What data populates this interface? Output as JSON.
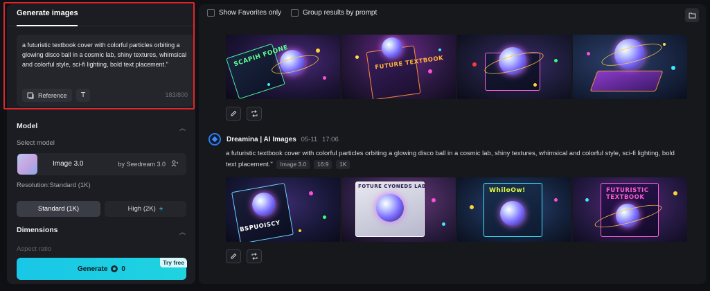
{
  "left_panel": {
    "tab_label": "Generate images",
    "prompt_text": "a futuristic textbook cover with colorful particles orbiting a glowing disco ball in a cosmic lab, shiny textures, whimsical and colorful style, sci-fi lighting, bold text placement.\"",
    "reference_label": "Reference",
    "text_tool_icon": "T",
    "char_count": "183/800",
    "model_section": {
      "title": "Model",
      "select_label": "Select model",
      "model_name": "Image 3.0",
      "model_by": "by Seedream 3.0",
      "resolution_label": "Resolution:Standard (1K)",
      "standard_label": "Standard (1K)",
      "high_label": "High (2K)",
      "high_plus": "+"
    },
    "dimensions_section": {
      "title": "Dimensions",
      "aspect_label": "Aspect ratio"
    },
    "generate": {
      "label": "Generate",
      "cost": "0",
      "badge": "Try free"
    }
  },
  "right_panel": {
    "show_favorites_label": "Show Favorites only",
    "group_results_label": "Group results by prompt",
    "result": {
      "author": "Dreamina | AI Images",
      "date": "05-11",
      "time": "17:06",
      "prompt": "a futuristic textbook cover with colorful particles orbiting a glowing disco ball in a cosmic lab, shiny textures, whimsical and colorful style, sci-fi lighting, bold text placement.\"",
      "tags": [
        "Image 3.0",
        "16:9",
        "1K"
      ]
    },
    "images_row1_captions": [
      "SCAPIH FOONE",
      "FUTURE TEXTBOOK",
      "",
      ""
    ],
    "images_row2_captions": [
      "BSPUOISCY",
      "FOTURE CYONEDS LAB",
      "WhiloOw!",
      "FUTURISTIC TEXTBOOK"
    ]
  },
  "icons": {
    "reference": "reference-image-icon",
    "text_tool": "text-format-icon",
    "model_settings": "sliders-icon",
    "chevron": "chevron-up-icon",
    "folder": "folder-icon",
    "edit": "pencil-icon",
    "regenerate": "regenerate-icon",
    "avatar": "dreamina-logo-icon",
    "coin": "credit-coin-icon"
  },
  "colors": {
    "accent_cyan": "#19c7e6",
    "highlight_red": "#e0262a",
    "avatar_blue": "#2d7df0",
    "panel_bg": "#1b1d22"
  }
}
